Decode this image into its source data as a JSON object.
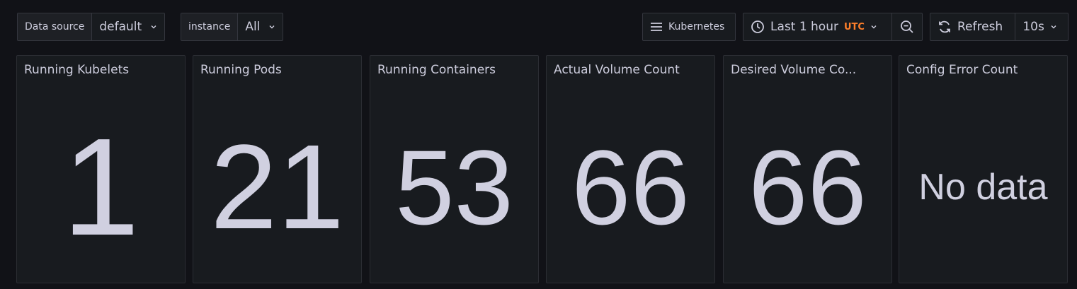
{
  "variables": {
    "datasource": {
      "label": "Data source",
      "value": "default"
    },
    "instance": {
      "label": "instance",
      "value": "All"
    }
  },
  "dashboard_link": {
    "icon": "hamburger-menu-icon",
    "label": "Kubernetes"
  },
  "time_picker": {
    "icon": "clock-icon",
    "label": "Last 1 hour",
    "timezone": "UTC",
    "zoom_icon": "zoom-out-icon"
  },
  "refresh": {
    "icon": "refresh-icon",
    "label": "Refresh",
    "interval": "10s"
  },
  "panels": [
    {
      "title": "Running Kubelets",
      "value": "1"
    },
    {
      "title": "Running Pods",
      "value": "21"
    },
    {
      "title": "Running Containers",
      "value": "53"
    },
    {
      "title": "Actual Volume Count",
      "value": "66"
    },
    {
      "title": "Desired Volume Co...",
      "value": "66"
    },
    {
      "title": "Config Error Count",
      "value": "No data"
    }
  ],
  "colors": {
    "background": "#111217",
    "panel": "#181b1f",
    "border": "#34363e",
    "text": "#ccccdc",
    "value": "#d0d0e0",
    "utc": "#ff7f2a"
  }
}
